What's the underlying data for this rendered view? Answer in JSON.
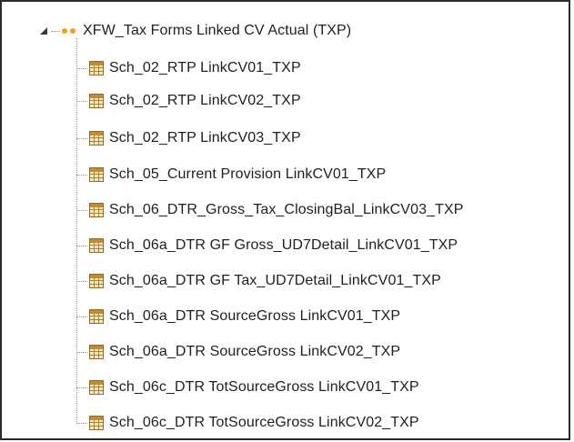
{
  "tree": {
    "root": {
      "label": "XFW_Tax Forms Linked CV Actual (TXP)",
      "expanded": true,
      "icon": "orange-dots-icon"
    },
    "children": [
      {
        "label": "Sch_02_RTP LinkCV01_TXP",
        "icon": "cube-view-grid-icon"
      },
      {
        "label": "Sch_02_RTP LinkCV02_TXP",
        "icon": "cube-view-grid-icon"
      },
      {
        "label": "Sch_02_RTP LinkCV03_TXP",
        "icon": "cube-view-grid-icon"
      },
      {
        "label": "Sch_05_Current Provision LinkCV01_TXP",
        "icon": "cube-view-grid-icon"
      },
      {
        "label": "Sch_06_DTR_Gross_Tax_ClosingBal_LinkCV03_TXP",
        "icon": "cube-view-grid-icon"
      },
      {
        "label": "Sch_06a_DTR GF Gross_UD7Detail_LinkCV01_TXP",
        "icon": "cube-view-grid-icon"
      },
      {
        "label": "Sch_06a_DTR GF Tax_UD7Detail_LinkCV01_TXP",
        "icon": "cube-view-grid-icon"
      },
      {
        "label": "Sch_06a_DTR SourceGross LinkCV01_TXP",
        "icon": "cube-view-grid-icon"
      },
      {
        "label": "Sch_06a_DTR SourceGross LinkCV02_TXP",
        "icon": "cube-view-grid-icon"
      },
      {
        "label": "Sch_06c_DTR TotSourceGross LinkCV01_TXP",
        "icon": "cube-view-grid-icon"
      },
      {
        "label": "Sch_06c_DTR TotSourceGross LinkCV02_TXP",
        "icon": "cube-view-grid-icon"
      }
    ]
  }
}
